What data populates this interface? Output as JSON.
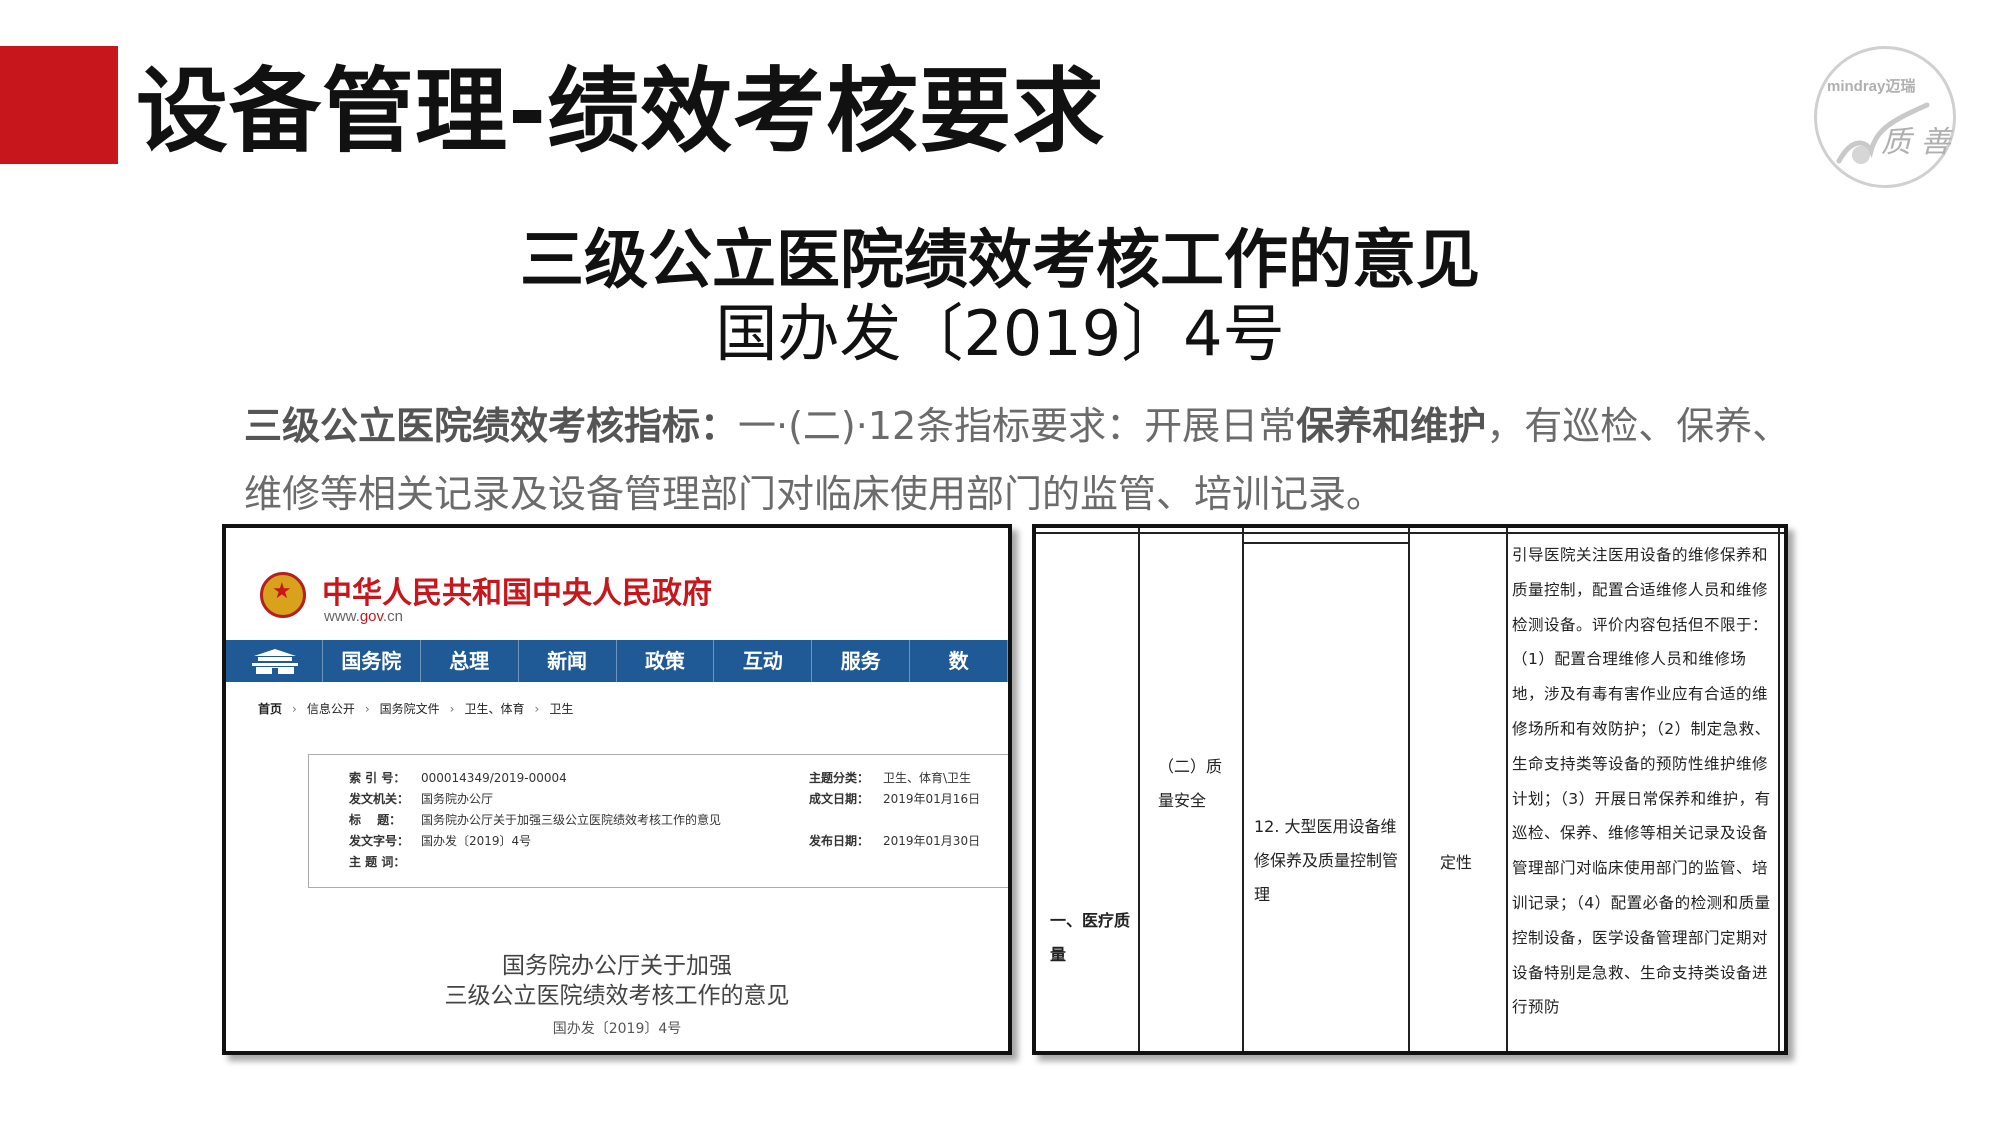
{
  "slide": {
    "title": "设备管理-绩效考核要求",
    "logo_text": "mindray迈瑞",
    "logo_glyph": "质 善"
  },
  "document": {
    "title": "三级公立医院绩效考核工作的意见",
    "subtitle": "国办发〔2019〕4号"
  },
  "paragraph": {
    "p1": "三级公立医院绩效考核指标：",
    "p2": "一·(二)·12条指标要求：开展日常",
    "p3": "保养和维护",
    "p4": "，有巡检、保养、维修等相关记录及设备管理部门对临床使用部门的监管、培训记录。"
  },
  "gov_site": {
    "name": "中华人民共和国中央人民政府",
    "url_prefix": "www.",
    "url_mid": "gov",
    "url_suffix": ".cn",
    "nav": [
      "国务院",
      "总理",
      "新闻",
      "政策",
      "互动",
      "服务",
      "数"
    ],
    "breadcrumb": [
      "首页",
      "信息公开",
      "国务院文件",
      "卫生、体育",
      "卫生"
    ],
    "meta": {
      "index_label": "索 引 号：",
      "index_value": "000014349/2019-00004",
      "issuer_label": "发文机关：",
      "issuer_value": "国务院办公厅",
      "title_label": "标　 题：",
      "title_value": "国务院办公厅关于加强三级公立医院绩效考核工作的意见",
      "docno_label": "发文字号：",
      "docno_value": "国办发〔2019〕4号",
      "subject_label": "主 题 词：",
      "subject_value": "",
      "category_label": "主题分类：",
      "category_value": "卫生、体育\\卫生",
      "date_label": "成文日期：",
      "date_value": "2019年01月16日",
      "pub_label": "发布日期：",
      "pub_value": "2019年01月30日"
    },
    "notice_line1": "国务院办公厅关于加强",
    "notice_line2": "三级公立医院绩效考核工作的意见",
    "notice_line3": "国办发〔2019〕4号"
  },
  "table": {
    "col1": "一、医疗质量",
    "col2": "（二）质量安全",
    "col3": "12. 大型医用设备维修保养及质量控制管理",
    "col4": "定性",
    "col5": "引导医院关注医用设备的维修保养和质量控制，配置合适维修人员和维修检测设备。评价内容包括但不限于：（1）配置合理维修人员和维修场地，涉及有毒有害作业应有合适的维修场所和有效防护；（2）制定急救、生命支持类等设备的预防性维护维修计划；（3）开展日常保养和维护，有巡检、保养、维修等相关记录及设备管理部门对临床使用部门的监管、培训记录；（4）配置必备的检测和质量控制设备，医学设备管理部门定期对设备特别是急救、生命支持类设备进行预防"
  }
}
